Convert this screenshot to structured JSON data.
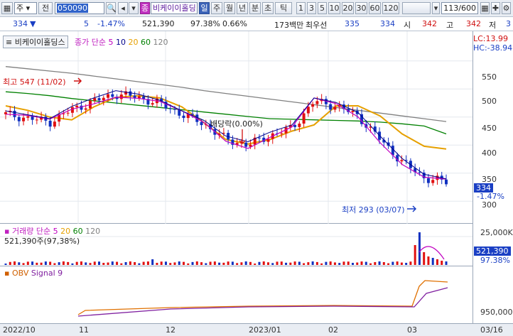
{
  "toolbar": {
    "mode": "주",
    "prev_label": "전",
    "code": "050090",
    "name_prefix": "종",
    "name": "비케이이홀딩",
    "periods": [
      "일",
      "주",
      "월",
      "년",
      "분",
      "초",
      "틱"
    ],
    "intervals": [
      "1",
      "3",
      "5",
      "10",
      "20",
      "30",
      "60",
      "120"
    ],
    "count": "113/600",
    "icons": [
      "grid-icon",
      "crosshair-icon",
      "settings-icon"
    ]
  },
  "quote": {
    "price": "334",
    "change": "5",
    "change_pct": "-1.47%",
    "volume": "521,390",
    "vol_ratio": "97.38%",
    "turnover": "0.66%",
    "amount": "173백만",
    "bid_label": "최우선",
    "bid": "335",
    "ask": "334",
    "open_label": "시",
    "open": "342",
    "high_label": "고",
    "high": "342",
    "low_label": "저",
    "low": "3"
  },
  "price_panel": {
    "title": "비케이이홀딩스",
    "ma_label": "종가 단순",
    "ma_periods": [
      "5",
      "10",
      "20",
      "60",
      "120"
    ],
    "ma_colors": [
      "#c000c0",
      "#00008b",
      "#e6a000",
      "#008000",
      "#808080"
    ],
    "lc": "LC:13.99",
    "hc": "HC:-38.94",
    "high_note": "최고 547 (11/02)",
    "low_note": "최저 293 (03/07)",
    "dividend_note": "배당락(0.00%)",
    "y_ticks": [
      "550",
      "500",
      "450",
      "400",
      "350",
      "300"
    ],
    "cur_price": "334",
    "cur_pct": "-1.47%"
  },
  "volume_panel": {
    "label": "거래량",
    "ma_label": "단순",
    "ma_periods": [
      "5",
      "20",
      "60",
      "120"
    ],
    "value_text": "521,390주(97,38%)",
    "y_ticks": [
      "25,000K"
    ],
    "cur_value": "521,390",
    "cur_pct": "97.38%"
  },
  "obv_panel": {
    "label": "OBV",
    "signal": "Signal 9",
    "y_ticks": [
      "950,000K"
    ]
  },
  "x_axis": [
    "2022/10",
    "11",
    "12",
    "2023/01",
    "02",
    "03",
    "03/16"
  ],
  "chart_data": {
    "type": "line",
    "title": "비케이이홀딩스",
    "xlabel": "",
    "ylabel": "",
    "ylim": [
      270,
      575
    ],
    "x_ticks": [
      "2022/10",
      "11",
      "12",
      "2023/01",
      "02",
      "03"
    ],
    "series": [
      {
        "name": "120",
        "values": [
          540,
          536,
          532,
          528,
          523,
          518,
          513,
          508,
          503,
          497,
          492,
          487,
          482,
          477,
          472,
          467,
          462,
          457,
          452,
          447,
          442
        ]
      },
      {
        "name": "60",
        "values": [
          495,
          492,
          488,
          483,
          479,
          475,
          471,
          467,
          463,
          459,
          455,
          451,
          447,
          446,
          445,
          444,
          443,
          441,
          438,
          434,
          420
        ]
      },
      {
        "name": "20",
        "values": [
          470,
          462,
          450,
          445,
          468,
          485,
          488,
          484,
          468,
          440,
          410,
          402,
          410,
          425,
          436,
          470,
          470,
          452,
          420,
          398,
          393
        ]
      }
    ],
    "close": [
      455,
      448,
      441,
      463,
      478,
      491,
      485,
      474,
      455,
      438,
      410,
      400,
      417,
      430,
      478,
      470,
      452,
      410,
      370,
      342,
      334
    ]
  }
}
